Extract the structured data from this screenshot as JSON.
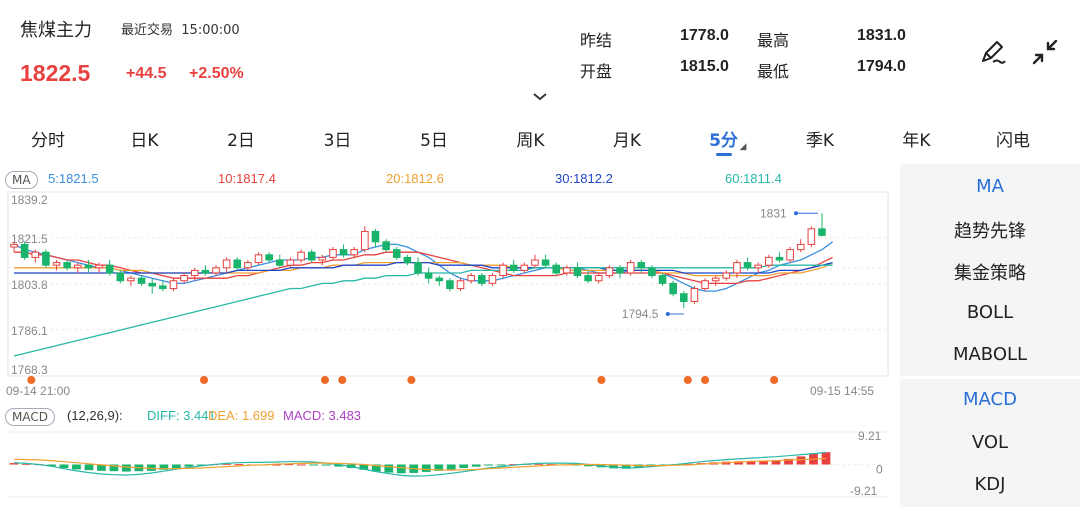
{
  "header": {
    "title": "焦煤主力",
    "last_trade_label": "最近交易",
    "last_trade_time": "15:00:00",
    "price": "1822.5",
    "change": "+44.5",
    "change_pct": "+2.50%"
  },
  "quote": {
    "prev_settle_label": "昨结",
    "prev_settle": "1778.0",
    "high_label": "最高",
    "high": "1831.0",
    "open_label": "开盘",
    "open": "1815.0",
    "low_label": "最低",
    "low": "1794.0"
  },
  "icons": {
    "edit": "pen-icon",
    "collapse": "collapse-arrows-icon",
    "expand": "chevron-down-icon"
  },
  "tabs": [
    {
      "label": "分时"
    },
    {
      "label": "日K"
    },
    {
      "label": "2日"
    },
    {
      "label": "3日"
    },
    {
      "label": "5日"
    },
    {
      "label": "周K"
    },
    {
      "label": "月K"
    },
    {
      "label": "5分",
      "active": true
    },
    {
      "label": "季K"
    },
    {
      "label": "年K"
    },
    {
      "label": "闪电"
    }
  ],
  "ma_legend": {
    "tag": "MA",
    "items": [
      {
        "text": "5:1821.5",
        "color": "#3a8fe0"
      },
      {
        "text": "10:1817.4",
        "color": "#e8413f"
      },
      {
        "text": "20:1812.6",
        "color": "#f0a030"
      },
      {
        "text": "30:1812.2",
        "color": "#1f45c8"
      },
      {
        "text": "60:1811.4",
        "color": "#28b8a8"
      }
    ]
  },
  "macd_legend": {
    "tag": "MACD",
    "params": "(12,26,9):",
    "diff": "DIFF: 3.441",
    "dea": "DEA: 1.699",
    "macd": "MACD: 3.483"
  },
  "colors": {
    "up": "#e8413f",
    "down": "#19b46b",
    "accent": "#2b6fd6"
  },
  "chart_data": {
    "type": "candlestick",
    "price_axis_labels": [
      "1839.2",
      "1821.5",
      "1803.8",
      "1786.1",
      "1768.3"
    ],
    "ylim": [
      1768.3,
      1839.2
    ],
    "time_start": "09-14 21:00",
    "time_end": "09-15 14:55",
    "high_mark": "1831",
    "low_mark": "1794.5",
    "candles": [
      [
        1818,
        1820,
        1816,
        1819
      ],
      [
        1819,
        1820,
        1813,
        1814
      ],
      [
        1814,
        1817,
        1812,
        1816
      ],
      [
        1816,
        1817,
        1810,
        1811
      ],
      [
        1811,
        1813,
        1809,
        1812
      ],
      [
        1812,
        1813,
        1809,
        1810
      ],
      [
        1810,
        1812,
        1808,
        1811
      ],
      [
        1811,
        1813,
        1808,
        1810
      ],
      [
        1810,
        1812,
        1808,
        1811
      ],
      [
        1811,
        1813,
        1807,
        1808
      ],
      [
        1808,
        1809,
        1804,
        1805
      ],
      [
        1805,
        1807,
        1803,
        1806
      ],
      [
        1806,
        1807,
        1803,
        1804
      ],
      [
        1804,
        1806,
        1800,
        1803
      ],
      [
        1803,
        1805,
        1801,
        1802
      ],
      [
        1802,
        1806,
        1801,
        1805
      ],
      [
        1805,
        1808,
        1804,
        1807
      ],
      [
        1807,
        1810,
        1805,
        1809
      ],
      [
        1809,
        1811,
        1807,
        1808
      ],
      [
        1808,
        1811,
        1807,
        1810
      ],
      [
        1810,
        1814,
        1808,
        1813
      ],
      [
        1813,
        1814,
        1809,
        1810
      ],
      [
        1810,
        1813,
        1809,
        1812
      ],
      [
        1812,
        1816,
        1811,
        1815
      ],
      [
        1815,
        1816,
        1812,
        1813
      ],
      [
        1813,
        1815,
        1810,
        1811
      ],
      [
        1811,
        1814,
        1810,
        1813
      ],
      [
        1813,
        1817,
        1812,
        1816
      ],
      [
        1816,
        1817,
        1812,
        1813
      ],
      [
        1813,
        1815,
        1811,
        1814
      ],
      [
        1814,
        1818,
        1813,
        1817
      ],
      [
        1817,
        1819,
        1814,
        1815
      ],
      [
        1815,
        1818,
        1814,
        1817
      ],
      [
        1817,
        1826,
        1816,
        1824
      ],
      [
        1824,
        1825,
        1818,
        1820
      ],
      [
        1820,
        1821,
        1816,
        1817
      ],
      [
        1817,
        1818,
        1813,
        1814
      ],
      [
        1814,
        1815,
        1811,
        1812
      ],
      [
        1812,
        1814,
        1807,
        1808
      ],
      [
        1808,
        1810,
        1804,
        1806
      ],
      [
        1806,
        1807,
        1803,
        1805
      ],
      [
        1805,
        1806,
        1801,
        1802
      ],
      [
        1802,
        1806,
        1801,
        1805
      ],
      [
        1805,
        1808,
        1804,
        1807
      ],
      [
        1807,
        1808,
        1803,
        1804
      ],
      [
        1804,
        1808,
        1803,
        1807
      ],
      [
        1807,
        1812,
        1806,
        1811
      ],
      [
        1811,
        1813,
        1808,
        1809
      ],
      [
        1809,
        1812,
        1808,
        1811
      ],
      [
        1811,
        1815,
        1810,
        1813
      ],
      [
        1813,
        1815,
        1810,
        1811
      ],
      [
        1811,
        1812,
        1807,
        1808
      ],
      [
        1808,
        1811,
        1807,
        1810
      ],
      [
        1810,
        1812,
        1806,
        1807
      ],
      [
        1807,
        1809,
        1804,
        1805
      ],
      [
        1805,
        1808,
        1804,
        1807
      ],
      [
        1807,
        1811,
        1806,
        1810
      ],
      [
        1810,
        1811,
        1806,
        1808
      ],
      [
        1808,
        1813,
        1807,
        1812
      ],
      [
        1812,
        1813,
        1808,
        1810
      ],
      [
        1810,
        1811,
        1806,
        1807
      ],
      [
        1807,
        1808,
        1803,
        1804
      ],
      [
        1804,
        1805,
        1799,
        1800
      ],
      [
        1800,
        1801,
        1794.5,
        1797
      ],
      [
        1797,
        1803,
        1796,
        1802
      ],
      [
        1802,
        1806,
        1801,
        1805
      ],
      [
        1805,
        1807,
        1803,
        1806
      ],
      [
        1806,
        1809,
        1805,
        1808
      ],
      [
        1808,
        1813,
        1806,
        1812
      ],
      [
        1812,
        1814,
        1809,
        1810
      ],
      [
        1810,
        1812,
        1808,
        1811
      ],
      [
        1811,
        1815,
        1810,
        1814
      ],
      [
        1814,
        1816,
        1812,
        1813
      ],
      [
        1813,
        1818,
        1812,
        1817
      ],
      [
        1817,
        1821,
        1816,
        1819
      ],
      [
        1819,
        1826,
        1818,
        1825
      ],
      [
        1825,
        1831,
        1822,
        1822.5
      ]
    ],
    "ma_series": [
      {
        "name": "MA5",
        "color": "#3a8fe0",
        "values": [
          1819,
          1817,
          1816,
          1815,
          1814,
          1813,
          1812,
          1811,
          1810,
          1810,
          1809,
          1808,
          1807,
          1806,
          1805,
          1804,
          1804,
          1805,
          1806,
          1807,
          1808,
          1809,
          1810,
          1811,
          1812,
          1813,
          1813,
          1813,
          1814,
          1814,
          1815,
          1815,
          1815,
          1817,
          1818,
          1819,
          1819,
          1818,
          1816,
          1814,
          1811,
          1808,
          1806,
          1805,
          1805,
          1805,
          1806,
          1807,
          1808,
          1809,
          1810,
          1810,
          1810,
          1810,
          1809,
          1808,
          1808,
          1808,
          1809,
          1809,
          1809,
          1808,
          1806,
          1804,
          1802,
          1801,
          1801,
          1802,
          1804,
          1806,
          1808,
          1809,
          1811,
          1812,
          1813,
          1815,
          1817,
          1820
        ]
      },
      {
        "name": "MA10",
        "color": "#e8413f",
        "values": [
          1816,
          1816,
          1815,
          1815,
          1814,
          1813,
          1813,
          1812,
          1811,
          1811,
          1810,
          1809,
          1808,
          1808,
          1807,
          1806,
          1806,
          1806,
          1806,
          1806,
          1806,
          1807,
          1807,
          1808,
          1809,
          1810,
          1811,
          1811,
          1812,
          1812,
          1813,
          1813,
          1814,
          1815,
          1815,
          1816,
          1816,
          1816,
          1816,
          1815,
          1814,
          1813,
          1812,
          1811,
          1810,
          1809,
          1808,
          1807,
          1807,
          1807,
          1807,
          1807,
          1808,
          1808,
          1808,
          1808,
          1808,
          1808,
          1808,
          1808,
          1808,
          1808,
          1807,
          1806,
          1805,
          1804,
          1804,
          1804,
          1804,
          1805,
          1805,
          1806,
          1807,
          1808,
          1809,
          1810,
          1812,
          1814
        ]
      },
      {
        "name": "MA20",
        "color": "#f0a030",
        "values": [
          1810,
          1810,
          1810,
          1810,
          1810,
          1810,
          1810,
          1810,
          1810,
          1810,
          1809,
          1809,
          1809,
          1808,
          1808,
          1808,
          1808,
          1808,
          1808,
          1808,
          1808,
          1808,
          1808,
          1808,
          1809,
          1809,
          1809,
          1810,
          1810,
          1810,
          1811,
          1811,
          1811,
          1812,
          1812,
          1812,
          1812,
          1812,
          1812,
          1812,
          1812,
          1812,
          1812,
          1811,
          1811,
          1811,
          1811,
          1810,
          1810,
          1810,
          1810,
          1810,
          1809,
          1809,
          1809,
          1809,
          1809,
          1809,
          1809,
          1809,
          1809,
          1808,
          1808,
          1808,
          1807,
          1807,
          1807,
          1807,
          1807,
          1807,
          1807,
          1807,
          1808,
          1808,
          1808,
          1809,
          1810,
          1812
        ]
      },
      {
        "name": "MA30",
        "color": "#1f45c8",
        "values": [
          1808,
          1808,
          1808,
          1808,
          1808,
          1808,
          1808,
          1808,
          1808,
          1808,
          1808,
          1808,
          1808,
          1808,
          1808,
          1808,
          1808,
          1808,
          1808,
          1808,
          1808,
          1809,
          1809,
          1809,
          1809,
          1809,
          1810,
          1810,
          1810,
          1810,
          1810,
          1811,
          1811,
          1811,
          1811,
          1811,
          1812,
          1812,
          1812,
          1812,
          1811,
          1811,
          1811,
          1811,
          1811,
          1810,
          1810,
          1810,
          1810,
          1810,
          1810,
          1810,
          1810,
          1810,
          1810,
          1810,
          1809,
          1809,
          1809,
          1809,
          1809,
          1809,
          1809,
          1808,
          1808,
          1808,
          1808,
          1808,
          1808,
          1808,
          1808,
          1808,
          1809,
          1809,
          1809,
          1810,
          1811,
          1812
        ]
      },
      {
        "name": "MA60",
        "color": "#28b8a8",
        "values": [
          1776,
          1777,
          1778,
          1779,
          1780,
          1781,
          1782,
          1783,
          1784,
          1785,
          1786,
          1787,
          1788,
          1789,
          1790,
          1791,
          1792,
          1793,
          1794,
          1795,
          1796,
          1797,
          1798,
          1799,
          1800,
          1801,
          1802,
          1802,
          1803,
          1804,
          1804,
          1805,
          1805,
          1806,
          1806,
          1807,
          1807,
          1807,
          1808,
          1808,
          1808,
          1808,
          1808,
          1809,
          1809,
          1809,
          1809,
          1809,
          1809,
          1810,
          1810,
          1810,
          1810,
          1810,
          1810,
          1810,
          1810,
          1810,
          1810,
          1810,
          1810,
          1810,
          1810,
          1810,
          1810,
          1810,
          1810,
          1810,
          1810,
          1810,
          1810,
          1811,
          1811,
          1811,
          1811,
          1811,
          1811,
          1811
        ]
      }
    ],
    "signal_markers": [
      1,
      11,
      18,
      19,
      23,
      34,
      39,
      40,
      44
    ],
    "macd_axis_labels": [
      "9.21",
      "0",
      "-9.21"
    ],
    "macd_ylim": [
      -9.21,
      9.21
    ],
    "macd_hist": [
      0.4,
      0.2,
      0.1,
      -0.5,
      -1.0,
      -1.4,
      -1.6,
      -1.8,
      -1.9,
      -2.0,
      -1.9,
      -1.8,
      -1.5,
      -1.0,
      -0.6,
      -0.2,
      0.1,
      0.2,
      0.1,
      0.0,
      -0.1,
      0.0,
      0.1,
      0.0,
      -0.1,
      -0.3,
      -0.6,
      -1.0,
      -1.5,
      -2.0,
      -2.3,
      -2.5,
      -2.4,
      -2.1,
      -1.8,
      -1.4,
      -1.0,
      -0.6,
      -0.3,
      -0.1,
      0.1,
      0.2,
      0.2,
      0.1,
      0.0,
      -0.2,
      -0.5,
      -0.8,
      -1.1,
      -1.2,
      -1.0,
      -0.7,
      -0.4,
      -0.1,
      0.2,
      0.4,
      0.6,
      0.8,
      0.9,
      1.0,
      1.1,
      1.2,
      1.6,
      2.3,
      3.0,
      3.483
    ],
    "macd_diff": [
      0.5,
      0.3,
      0.0,
      -0.5,
      -1.2,
      -1.8,
      -2.3,
      -2.7,
      -2.9,
      -3.0,
      -2.8,
      -2.4,
      -1.9,
      -1.3,
      -0.8,
      -0.4,
      0.0,
      0.3,
      0.5,
      0.6,
      0.6,
      0.7,
      0.8,
      0.8,
      0.7,
      0.4,
      0.0,
      -0.6,
      -1.3,
      -2.0,
      -2.6,
      -3.1,
      -3.3,
      -3.2,
      -2.9,
      -2.5,
      -2.0,
      -1.5,
      -1.0,
      -0.6,
      -0.2,
      0.1,
      0.3,
      0.4,
      0.4,
      0.3,
      0.0,
      -0.4,
      -0.8,
      -1.0,
      -0.9,
      -0.6,
      -0.3,
      0.0,
      0.4,
      0.8,
      1.1,
      1.4,
      1.6,
      1.8,
      2.0,
      2.2,
      2.5,
      2.8,
      3.1,
      3.441
    ],
    "macd_dea": [
      1.5,
      1.4,
      1.3,
      1.1,
      0.8,
      0.5,
      0.2,
      -0.1,
      -0.4,
      -0.7,
      -0.9,
      -1.1,
      -1.2,
      -1.2,
      -1.1,
      -1.0,
      -0.8,
      -0.6,
      -0.4,
      -0.2,
      -0.1,
      0.1,
      0.2,
      0.3,
      0.4,
      0.4,
      0.3,
      0.2,
      0.0,
      -0.3,
      -0.6,
      -0.9,
      -1.2,
      -1.4,
      -1.5,
      -1.6,
      -1.5,
      -1.4,
      -1.2,
      -1.0,
      -0.8,
      -0.6,
      -0.4,
      -0.2,
      -0.1,
      0.0,
      0.0,
      0.0,
      -0.1,
      -0.2,
      -0.3,
      -0.3,
      -0.3,
      -0.2,
      -0.1,
      0.1,
      0.3,
      0.5,
      0.7,
      0.9,
      1.0,
      1.1,
      1.3,
      1.4,
      1.5,
      1.699
    ]
  },
  "indicators": {
    "main": [
      {
        "label": "MA",
        "active": true
      },
      {
        "label": "趋势先锋"
      },
      {
        "label": "集金策略"
      },
      {
        "label": "BOLL"
      },
      {
        "label": "MABOLL"
      }
    ],
    "sub": [
      {
        "label": "MACD",
        "active": true
      },
      {
        "label": "VOL"
      },
      {
        "label": "KDJ"
      }
    ]
  }
}
